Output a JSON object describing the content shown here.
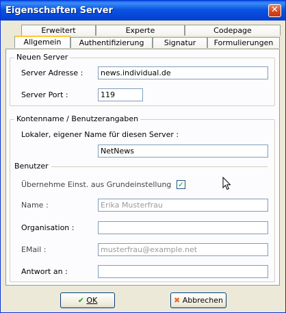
{
  "window": {
    "title": "Eigenschaften Server",
    "close_glyph": "✕"
  },
  "tabs_back": [
    "Erweitert",
    "Experte",
    "Codepage"
  ],
  "tabs_front": [
    "Allgemein",
    "Authentifizierung",
    "Signatur",
    "Formulierungen"
  ],
  "active_tab": "Allgemein",
  "neuer_server": {
    "legend": "Neuen Server",
    "adresse_label": "Server Adresse :",
    "adresse_value": "news.individual.de",
    "port_label": "Server Port :",
    "port_value": "119"
  },
  "konten": {
    "legend": "Kontenname / Benutzerangaben",
    "lokal_label": "Lokaler, eigener Name für diesen Server :",
    "lokal_value": "NetNews"
  },
  "benutzer": {
    "legend": "Benutzer",
    "uebernehme_label": "Übernehme Einst. aus Grundeinstellung",
    "uebernehme_checked": true,
    "name_label": "Name :",
    "name_value": "Erika Musterfrau",
    "org_label": "Organisation :",
    "org_value": "",
    "email_label": "EMail :",
    "email_value": "musterfrau@example.net",
    "antwort_label": "Antwort an :",
    "antwort_value": ""
  },
  "buttons": {
    "ok_label": "OK",
    "ok_icon": "checkmark-icon",
    "abbrechen_label": "Abbrechen",
    "abbrechen_icon": "cross-icon"
  },
  "colors": {
    "titlebar": "#0a54e2",
    "dialog_bg": "#ece9d8",
    "tab_accent": "#ffc83c",
    "check_green": "#21a121",
    "cancel_orange": "#e8682a"
  }
}
